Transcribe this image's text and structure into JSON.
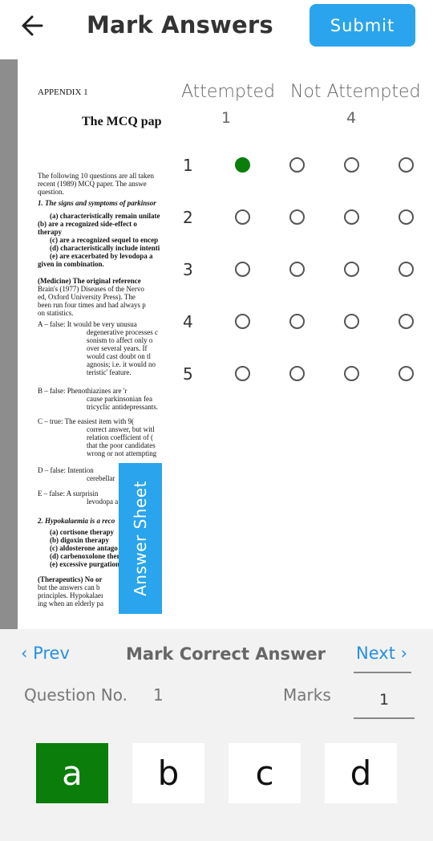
{
  "header": {
    "title": "Mark Answers",
    "submit_label": "Submit",
    "back_icon": "arrow-left-icon"
  },
  "document": {
    "lines": [
      "APPENDIX 1",
      "The MCQ pap",
      "The following 10 questions are all taken",
      "recent (1989) MCQ paper. The answe",
      "question.",
      "1.  The signs and symptoms of parkinsor",
      "(a)  characteristically remain unilate",
      "(b)  are a recognized side-effect o",
      "       therapy",
      "(c)  are a recognized sequel to encep",
      "(d)  characteristically include intenti",
      "(e)  are exacerbated by levodopa a",
      "       given in combination.",
      "(Medicine)  The original reference",
      "Brain's (1977) Diseases of the Nervo",
      "ed, Oxford University Press). The",
      "been run four times and had always p",
      "on statistics.",
      "A – false:   It would be very unusua",
      "degenerative processes c",
      "sonism to affect only o",
      "over several years. If",
      "would cast doubt on tl",
      "agnosis; i.e. it would no",
      "teristic' feature.",
      "B – false:   Phenothiazines  are  'r",
      "cause  parkinsonian fea",
      "tricyclic antidepressants.",
      "C – true:    The easiest item with 9(",
      "correct answer, but witl",
      "relation coefficient of (",
      "that the poor candidates",
      "wrong or not attempting",
      "D – false:   Intention",
      "cerebellar",
      "E – false:   A surprisin",
      "levodopa a",
      "2.  Hypokalaemia is a reco",
      "(a)  cortisone therapy",
      "(b)  digoxin therapy",
      "(c)  aldosterone antago",
      "(d)  carbenoxolone ther",
      "(e)  excessive purgation",
      "(Therapeutics)  No or",
      "but the answers can b",
      "principles. Hypokalaeı",
      "ing when an elderly pa"
    ]
  },
  "grid": {
    "attempted_label": "Attempted",
    "attempted_count": "1",
    "not_attempted_label": "Not Attempted",
    "not_attempted_count": "4",
    "questions": [
      {
        "num": "1",
        "selected": 0
      },
      {
        "num": "2",
        "selected": -1
      },
      {
        "num": "3",
        "selected": -1
      },
      {
        "num": "4",
        "selected": -1
      },
      {
        "num": "5",
        "selected": -1
      }
    ],
    "options_per_question": 4,
    "selected_color": "#0a7d0a"
  },
  "answer_sheet_label": "Answer Sheet",
  "panel": {
    "prev_label": "Prev",
    "next_label": "Next",
    "mark_correct_label": "Mark Correct Answer",
    "question_no_label": "Question No.",
    "question_no_value": "1",
    "marks_label": "Marks",
    "marks_value": "1",
    "options": [
      "a",
      "b",
      "c",
      "d"
    ],
    "selected_option": "a"
  },
  "colors": {
    "accent": "#2aa4ec",
    "link": "#2a8fe0",
    "selected": "#0a7d0a"
  }
}
